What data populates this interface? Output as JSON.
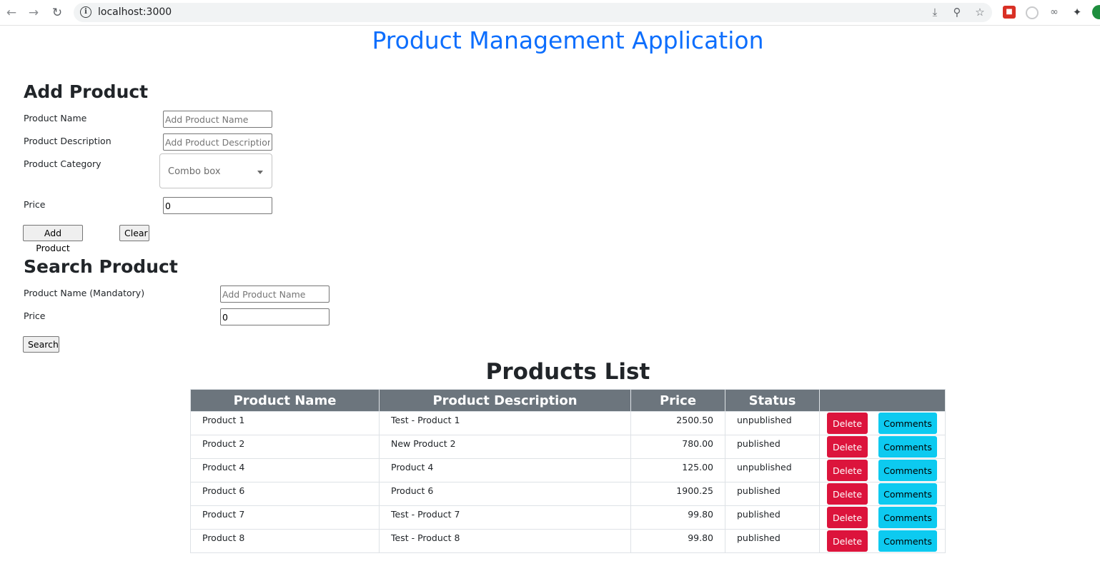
{
  "browser": {
    "url": "localhost:3000",
    "info_icon": "info-icon",
    "icons": [
      "back-arrow-icon",
      "forward-arrow-icon",
      "reload-icon",
      "install-icon",
      "zoom-icon",
      "bookmark-star-icon",
      "extension-red-icon",
      "extension-circle-icon",
      "extension-bike-icon",
      "puzzle-icon",
      "avatar"
    ]
  },
  "app": {
    "title": "Product Management Application",
    "title_color": "#0d6efd"
  },
  "add_product": {
    "heading": "Add Product",
    "name_label": "Product Name",
    "name_placeholder": "Add Product Name",
    "description_label": "Product Description",
    "description_placeholder": "Add Product Description",
    "category_label": "Product Category",
    "category_combo_text": "Combo box",
    "price_label": "Price",
    "price_value": "0",
    "add_button": "Add Product",
    "clear_button": "Clear"
  },
  "search_product": {
    "heading": "Search Product",
    "name_label": "Product Name (Mandatory)",
    "name_placeholder": "Add Product Name",
    "price_label": "Price",
    "price_value": "0",
    "search_button": "Search"
  },
  "products_list": {
    "heading": "Products List",
    "columns": [
      "Product Name",
      "Product Description",
      "Price",
      "Status",
      ""
    ],
    "delete_label": "Delete",
    "comments_label": "Comments",
    "delete_color": "#dc143c",
    "comments_color": "#0dcaf0",
    "header_color": "#6c757d",
    "rows": [
      {
        "name": "Product 1",
        "description": "Test - Product 1",
        "price": "2500.50",
        "status": "unpublished"
      },
      {
        "name": "Product 2",
        "description": "New Product 2",
        "price": "780.00",
        "status": "published"
      },
      {
        "name": "Product 4",
        "description": "Product 4",
        "price": "125.00",
        "status": "unpublished"
      },
      {
        "name": "Product 6",
        "description": "Product 6",
        "price": "1900.25",
        "status": "published"
      },
      {
        "name": "Product 7",
        "description": "Test - Product 7",
        "price": "99.80",
        "status": "published"
      },
      {
        "name": "Product 8",
        "description": "Test - Product 8",
        "price": "99.80",
        "status": "published"
      }
    ]
  }
}
